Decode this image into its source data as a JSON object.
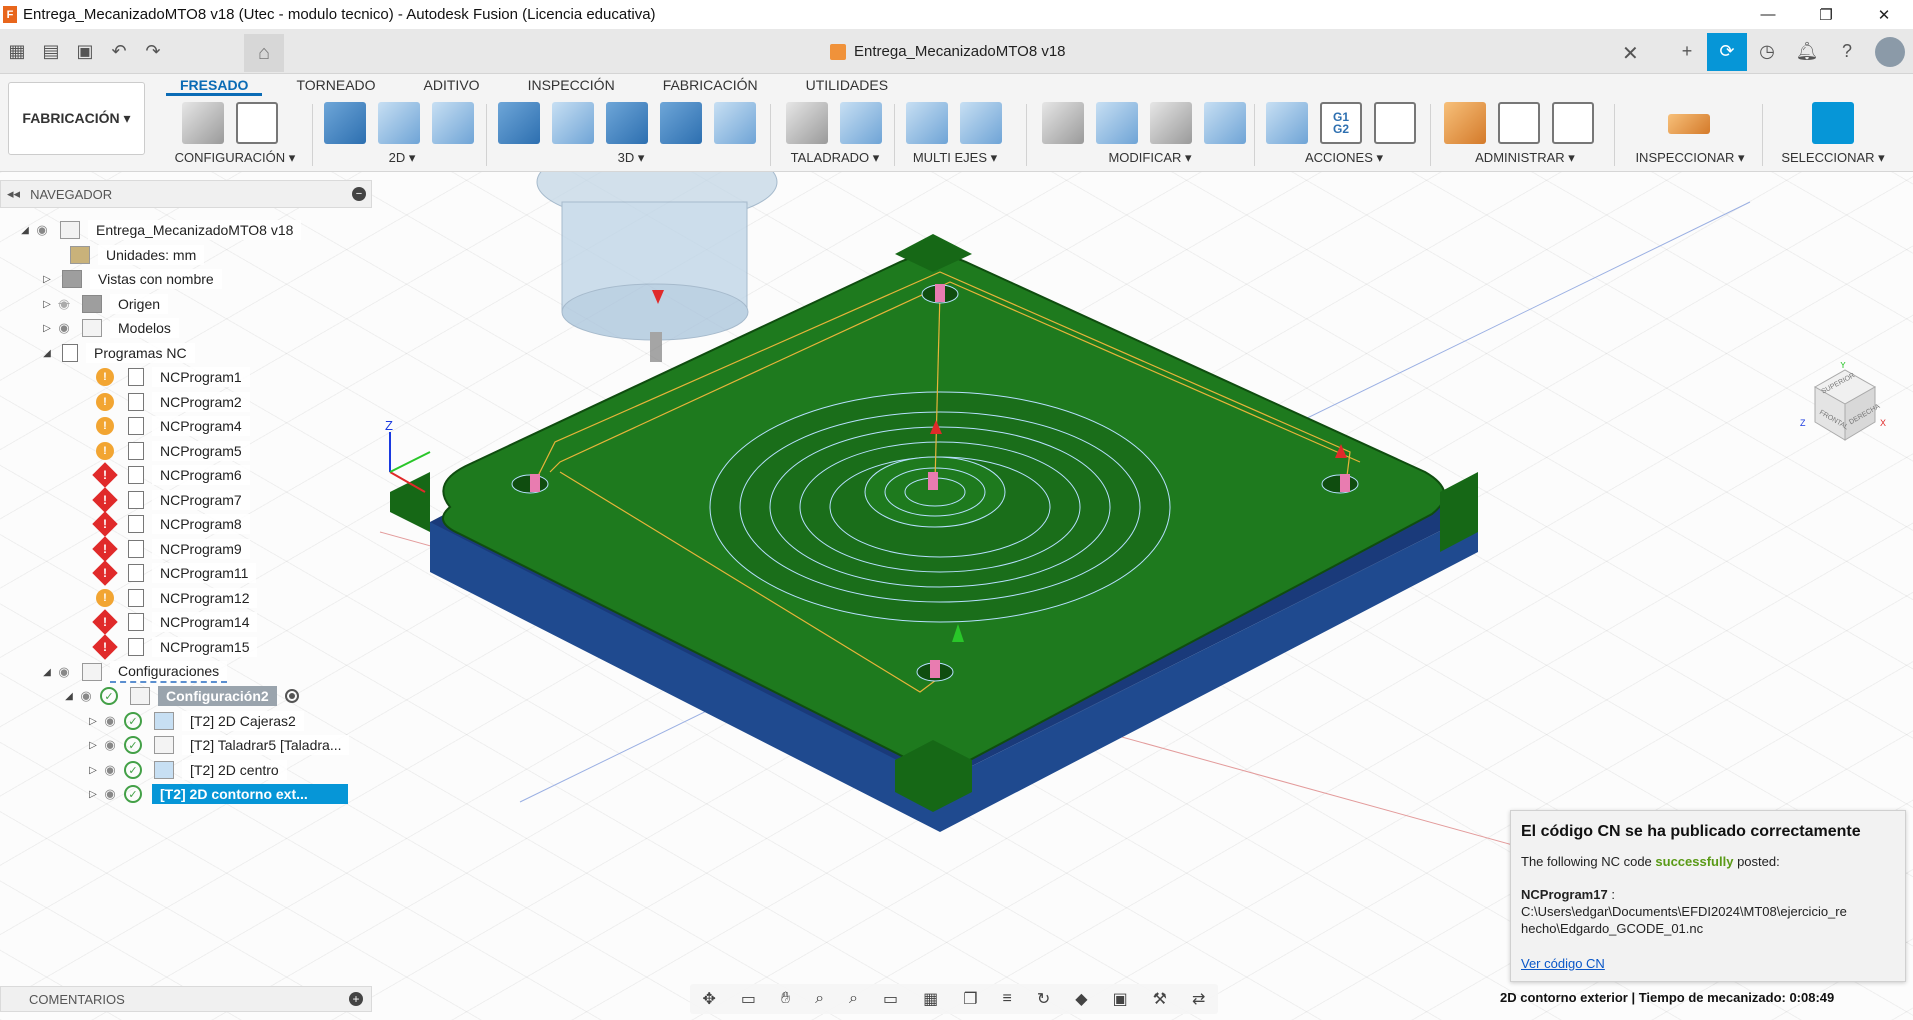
{
  "window": {
    "title": "Entrega_MecanizadoMTO8 v18 (Utec - modulo tecnico) - Autodesk Fusion (Licencia educativa)",
    "app_logo": "F",
    "controls": {
      "minimize": "—",
      "maximize": "❐",
      "close": "✕"
    }
  },
  "document_tab": {
    "title": "Entrega_MecanizadoMTO8 v18",
    "close": "✕"
  },
  "ribbon": {
    "workspace": "FABRICACIÓN ▾",
    "tabs": [
      "FRESADO",
      "TORNEADO",
      "ADITIVO",
      "INSPECCIÓN",
      "FABRICACIÓN",
      "UTILIDADES"
    ],
    "groups": {
      "config": "CONFIGURACIÓN ▾",
      "twod": "2D ▾",
      "threed": "3D ▾",
      "drilling": "TALADRADO ▾",
      "multiaxis": "MULTI EJES ▾",
      "modify": "MODIFICAR ▾",
      "actions": "ACCIONES ▾",
      "manage": "ADMINISTRAR ▾",
      "inspect": "INSPECCIONAR ▾",
      "select": "SELECCIONAR ▾"
    },
    "actions_g1g2": "G1\nG2"
  },
  "browser": {
    "header": "NAVEGADOR",
    "root": "Entrega_MecanizadoMTO8 v18",
    "units": "Unidades: mm",
    "named_views": "Vistas con nombre",
    "origin": "Origen",
    "models": "Modelos",
    "nc_programs": "Programas NC",
    "programs": [
      {
        "name": "NCProgram1",
        "status": "warning"
      },
      {
        "name": "NCProgram2",
        "status": "warning"
      },
      {
        "name": "NCProgram4",
        "status": "warning"
      },
      {
        "name": "NCProgram5",
        "status": "warning"
      },
      {
        "name": "NCProgram6",
        "status": "error"
      },
      {
        "name": "NCProgram7",
        "status": "error"
      },
      {
        "name": "NCProgram8",
        "status": "error"
      },
      {
        "name": "NCProgram9",
        "status": "error"
      },
      {
        "name": "NCProgram11",
        "status": "error"
      },
      {
        "name": "NCProgram12",
        "status": "warning"
      },
      {
        "name": "NCProgram14",
        "status": "error"
      },
      {
        "name": "NCProgram15",
        "status": "error"
      }
    ],
    "setups": "Configuraciones",
    "setup2": "Configuración2",
    "operations": [
      {
        "name": "[T2] 2D Cajeras2"
      },
      {
        "name": "[T2] Taladrar5 [Taladra..."
      },
      {
        "name": "[T2] 2D centro"
      },
      {
        "name": "[T2] 2D contorno ext..."
      }
    ]
  },
  "comments": "COMENTARIOS",
  "viewport": {
    "axis_z": "Z",
    "viewcube_x": "X",
    "viewcube_y": "Y",
    "viewcube_z": "Z",
    "viewcube_faces": {
      "top": "SUPERIOR",
      "front": "FRONTAL",
      "right": "DERECHA"
    }
  },
  "toast": {
    "title": "El código CN se ha publicado correctamente",
    "line_prefix": "The following NC code ",
    "line_success": "successfully",
    "line_suffix": " posted:",
    "program": "NCProgram17",
    "path": " : C:\\Users\\edgar\\Documents\\EFDI2024\\MT08\\ejercicio_re hecho\\Edgardo_GCODE_01.nc",
    "link": "Ver código CN"
  },
  "status": "2D contorno exterior | Tiempo de mecanizado: 0:08:49",
  "colors": {
    "accent": "#0696d7",
    "part_green": "#1e7a1e",
    "part_edge": "#1a3a7a"
  }
}
